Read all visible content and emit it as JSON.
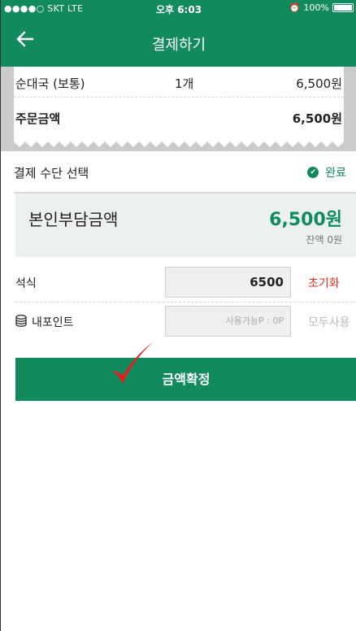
{
  "status_bar": {
    "carrier": "●●●●○ SKT  LTE",
    "time": "오후 6:03",
    "battery": "100%"
  },
  "header": {
    "title": "결제하기",
    "back_icon": "arrow-left-icon"
  },
  "order": {
    "items": [
      {
        "name": "순대국 (보통)",
        "qty": "1개",
        "price": "6,500원"
      }
    ],
    "total_label": "주문금액",
    "total_value": "6,500원"
  },
  "payment_method": {
    "title": "결제 수단 선택",
    "status": "완료"
  },
  "self_pay": {
    "label": "본인부담금액",
    "value": "6,500원",
    "balance": "잔액 0원"
  },
  "meal": {
    "label": "석식",
    "value": "6500",
    "reset": "초기화"
  },
  "points": {
    "label": "내포인트",
    "placeholder": "사용가능P : 0P",
    "use_all": "모두사용"
  },
  "confirm": {
    "label": "금액확정"
  },
  "colors": {
    "primary": "#118a5e",
    "accent_red": "#e0301e"
  }
}
